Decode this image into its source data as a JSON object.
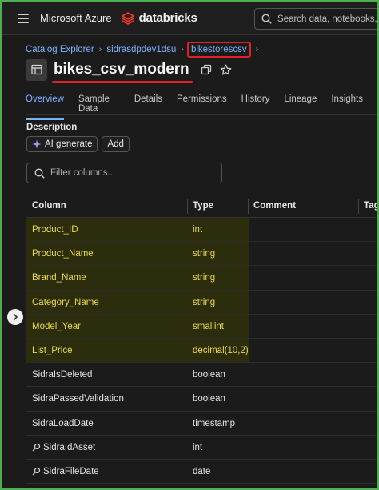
{
  "topbar": {
    "brand": "Microsoft Azure",
    "product": "databricks",
    "search_placeholder": "Search data, notebooks, recents"
  },
  "breadcrumb": {
    "items": [
      "Catalog Explorer",
      "sidrasdpdev1dsu",
      "bikestorescsv"
    ],
    "highlighted_index": 2
  },
  "title": "bikes_csv_modern",
  "tabs": [
    "Overview",
    "Sample Data",
    "Details",
    "Permissions",
    "History",
    "Lineage",
    "Insights"
  ],
  "active_tab": "Overview",
  "description": {
    "label": "Description",
    "ai_button": "AI generate",
    "add_button": "Add"
  },
  "filter": {
    "placeholder": "Filter columns..."
  },
  "table": {
    "headers": [
      "Column",
      "Type",
      "Comment",
      "Tags"
    ],
    "rows": [
      {
        "name": "Product_ID",
        "type": "int",
        "highlighted": true,
        "key_icon": false
      },
      {
        "name": "Product_Name",
        "type": "string",
        "highlighted": true,
        "key_icon": false
      },
      {
        "name": "Brand_Name",
        "type": "string",
        "highlighted": true,
        "key_icon": false
      },
      {
        "name": "Category_Name",
        "type": "string",
        "highlighted": true,
        "key_icon": false
      },
      {
        "name": "Model_Year",
        "type": "smallint",
        "highlighted": true,
        "key_icon": false
      },
      {
        "name": "List_Price",
        "type": "decimal(10,2)",
        "highlighted": true,
        "key_icon": false
      },
      {
        "name": "SidraIsDeleted",
        "type": "boolean",
        "highlighted": false,
        "key_icon": false
      },
      {
        "name": "SidraPassedValidation",
        "type": "boolean",
        "highlighted": false,
        "key_icon": false
      },
      {
        "name": "SidraLoadDate",
        "type": "timestamp",
        "highlighted": false,
        "key_icon": false
      },
      {
        "name": "SidraIdAsset",
        "type": "int",
        "highlighted": false,
        "key_icon": true
      },
      {
        "name": "SidraFileDate",
        "type": "date",
        "highlighted": false,
        "key_icon": true
      }
    ]
  },
  "colors": {
    "accent_link": "#7cb3ff",
    "highlight_text": "#e8d94a",
    "highlight_bg": "#2c2d0c",
    "annotation_red": "#e0202a",
    "frame_green": "#4caf50",
    "databricks_logo": "#ff3621"
  }
}
